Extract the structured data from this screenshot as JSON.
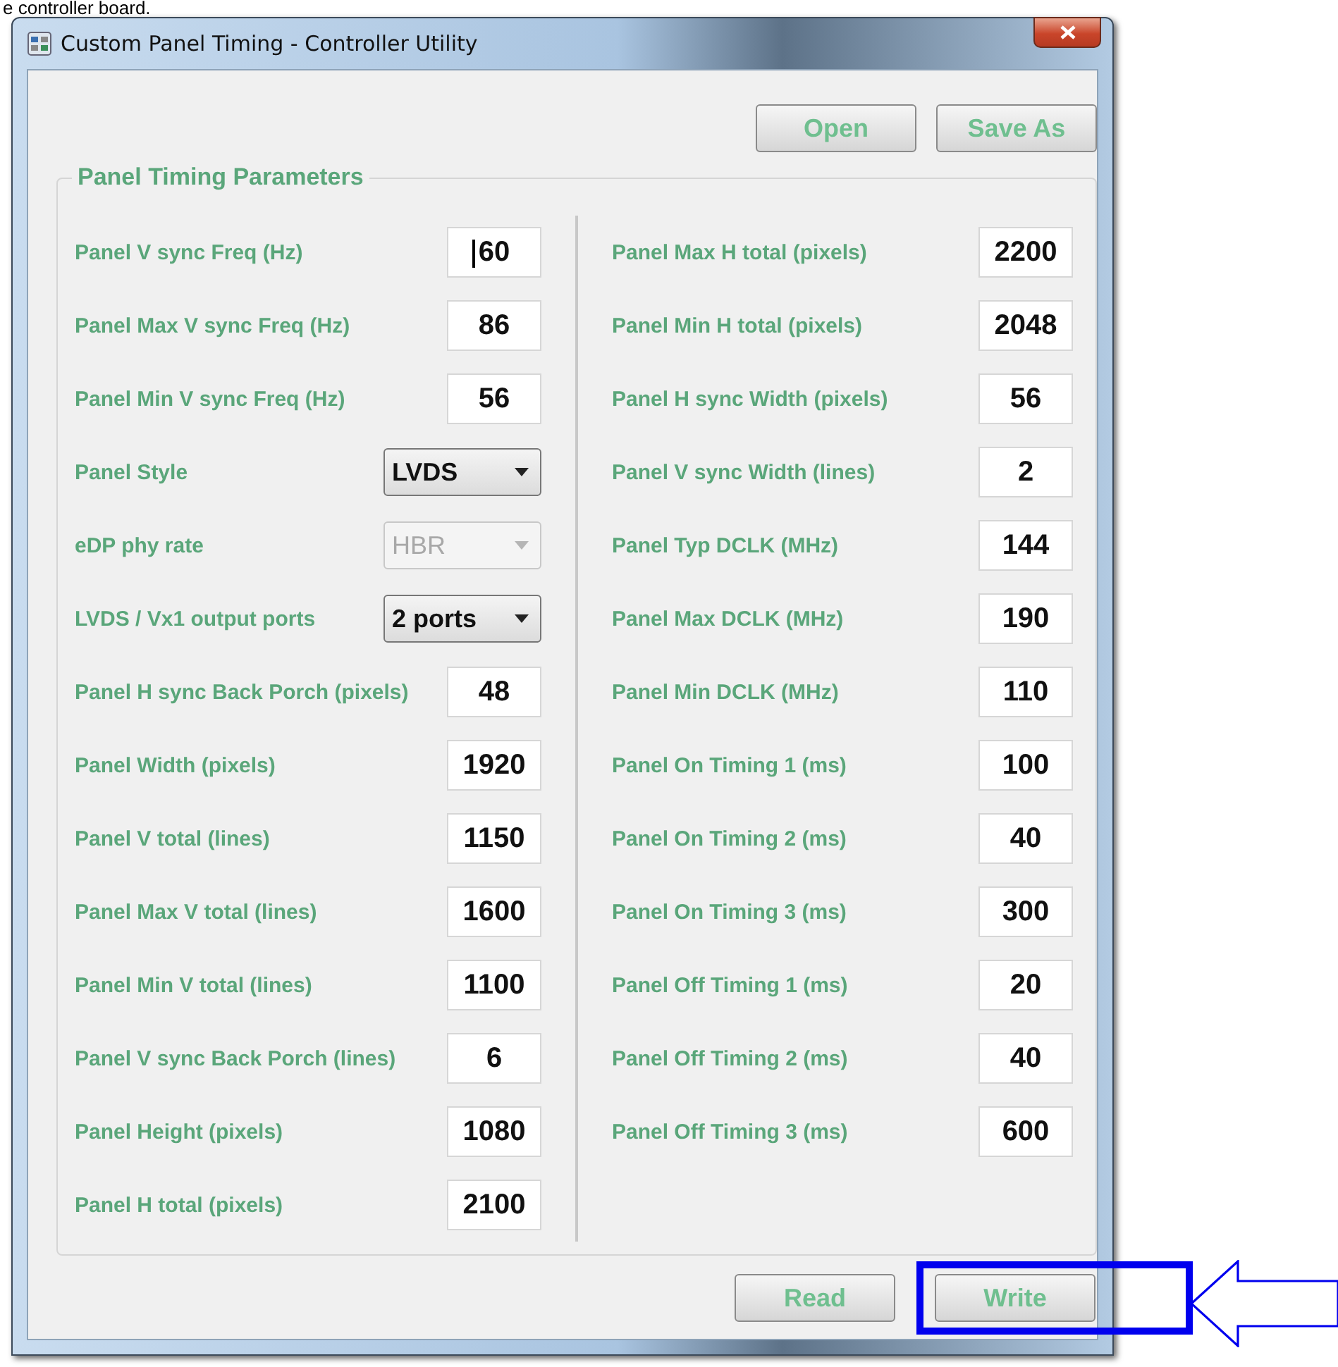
{
  "caption": "e controller board.",
  "window": {
    "title": "Custom Panel Timing - Controller Utility"
  },
  "top_buttons": [
    "Open",
    "Save As"
  ],
  "group": {
    "title": "Panel Timing Parameters",
    "left": [
      {
        "kind": "text",
        "label": "Panel V sync Freq (Hz)",
        "value": "60",
        "focused": true
      },
      {
        "kind": "text",
        "label": "Panel Max V sync Freq (Hz)",
        "value": "86",
        "focused": false
      },
      {
        "kind": "text",
        "label": "Panel Min V sync Freq (Hz)",
        "value": "56",
        "focused": false
      },
      {
        "kind": "select",
        "label": "Panel Style",
        "value": "LVDS",
        "disabled": false
      },
      {
        "kind": "select",
        "label": "eDP phy rate",
        "value": "HBR",
        "disabled": true
      },
      {
        "kind": "select",
        "label": "LVDS / Vx1 output ports",
        "value": "2 ports",
        "disabled": false
      },
      {
        "kind": "text",
        "label": "Panel H sync Back Porch (pixels)",
        "value": "48",
        "focused": false
      },
      {
        "kind": "text",
        "label": "Panel Width (pixels)",
        "value": "1920",
        "focused": false
      },
      {
        "kind": "text",
        "label": "Panel V total (lines)",
        "value": "1150",
        "focused": false
      },
      {
        "kind": "text",
        "label": "Panel Max V total (lines)",
        "value": "1600",
        "focused": false
      },
      {
        "kind": "text",
        "label": "Panel Min V total (lines)",
        "value": "1100",
        "focused": false
      },
      {
        "kind": "text",
        "label": "Panel V sync Back Porch (lines)",
        "value": "6",
        "focused": false
      },
      {
        "kind": "text",
        "label": "Panel Height (pixels)",
        "value": "1080",
        "focused": false
      },
      {
        "kind": "text",
        "label": "Panel H total (pixels)",
        "value": "2100",
        "focused": false
      }
    ],
    "right": [
      {
        "kind": "text",
        "label": "Panel Max H total (pixels)",
        "value": "2200",
        "focused": false
      },
      {
        "kind": "text",
        "label": "Panel Min H total (pixels)",
        "value": "2048",
        "focused": false
      },
      {
        "kind": "text",
        "label": "Panel H sync Width (pixels)",
        "value": "56",
        "focused": false
      },
      {
        "kind": "text",
        "label": "Panel V sync Width (lines)",
        "value": "2",
        "focused": false
      },
      {
        "kind": "text",
        "label": "Panel Typ DCLK (MHz)",
        "value": "144",
        "focused": false
      },
      {
        "kind": "text",
        "label": "Panel Max DCLK (MHz)",
        "value": "190",
        "focused": false
      },
      {
        "kind": "text",
        "label": "Panel Min DCLK (MHz)",
        "value": "110",
        "focused": false
      },
      {
        "kind": "text",
        "label": "Panel On Timing 1 (ms)",
        "value": "100",
        "focused": false
      },
      {
        "kind": "text",
        "label": "Panel On Timing 2 (ms)",
        "value": "40",
        "focused": false
      },
      {
        "kind": "text",
        "label": "Panel On Timing 3 (ms)",
        "value": "300",
        "focused": false
      },
      {
        "kind": "text",
        "label": "Panel Off Timing 1 (ms)",
        "value": "20",
        "focused": false
      },
      {
        "kind": "text",
        "label": "Panel Off Timing 2 (ms)",
        "value": "40",
        "focused": false
      },
      {
        "kind": "text",
        "label": "Panel Off Timing 3 (ms)",
        "value": "600",
        "focused": false
      }
    ]
  },
  "bottom_buttons": [
    {
      "label": "Read",
      "kind": "plain"
    },
    {
      "label": "Write",
      "kind": "framed"
    }
  ]
}
